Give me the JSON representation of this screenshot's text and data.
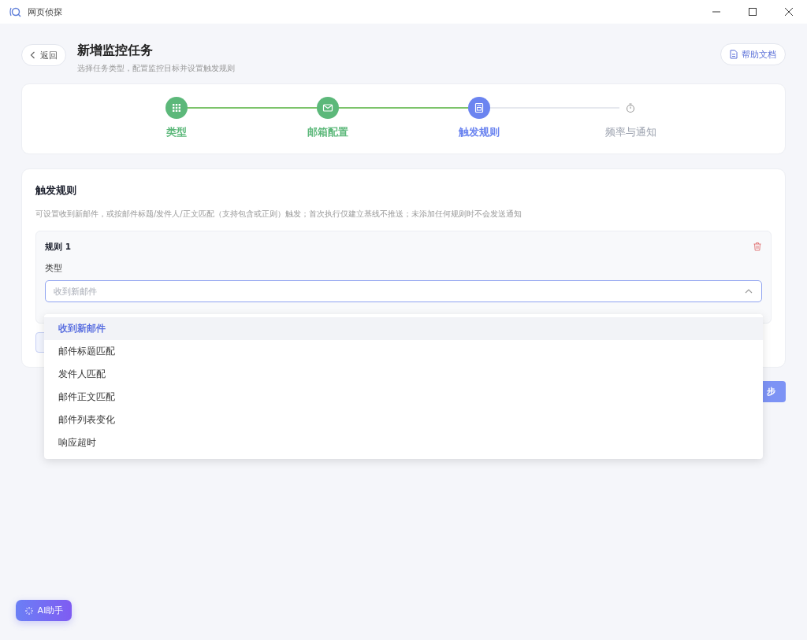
{
  "window": {
    "title": "网页侦探"
  },
  "header": {
    "back": "返回",
    "title": "新增监控任务",
    "subtitle": "选择任务类型，配置监控目标并设置触发规则",
    "help": "帮助文档"
  },
  "steps": [
    {
      "label": "类型",
      "done": true,
      "selected": false
    },
    {
      "label": "邮箱配置",
      "done": true,
      "selected": false
    },
    {
      "label": "触发规则",
      "done": false,
      "selected": true
    },
    {
      "label": "频率与通知",
      "done": false,
      "selected": false
    }
  ],
  "rules_card": {
    "title": "触发规则",
    "description": "可设置收到新邮件，或按邮件标题/发件人/正文匹配（支持包含或正则）触发；首次执行仅建立基线不推送；未添加任何规则时不会发送通知",
    "rules": [
      {
        "title": "规则 1",
        "type_label": "类型",
        "type_field": {
          "placeholder": "收到新邮件",
          "expanded": true
        }
      }
    ]
  },
  "dropdown": [
    {
      "label": "收到新邮件",
      "selected": true
    },
    {
      "label": "邮件标题匹配",
      "selected": false
    },
    {
      "label": "发件人匹配",
      "selected": false
    },
    {
      "label": "邮件正文匹配",
      "selected": false
    },
    {
      "label": "邮件列表变化",
      "selected": false
    },
    {
      "label": "响应超时",
      "selected": false
    }
  ],
  "next_button": "步",
  "ai_button": "AI助手"
}
